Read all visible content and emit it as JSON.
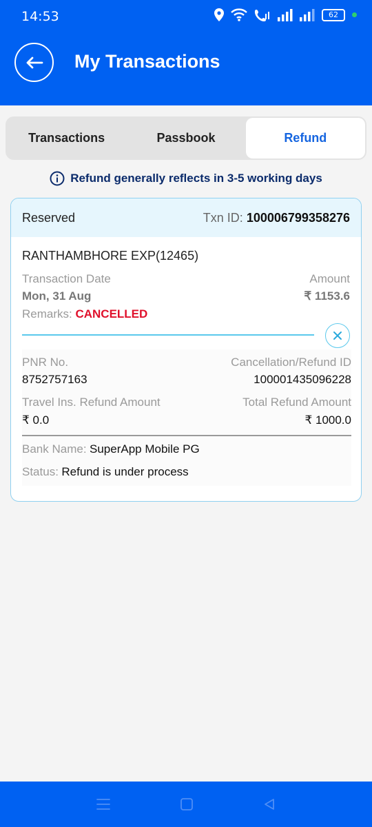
{
  "status_bar": {
    "time": "14:53",
    "battery": "62"
  },
  "header": {
    "title": "My Transactions"
  },
  "tabs": [
    {
      "label": "Transactions"
    },
    {
      "label": "Passbook"
    },
    {
      "label": "Refund"
    }
  ],
  "info": {
    "message": "Refund generally reflects in 3-5 working days"
  },
  "card": {
    "status": "Reserved",
    "txn_label": "Txn ID:",
    "txn_id": "100006799358276",
    "train": "RANTHAMBHORE EXP(12465)",
    "transaction_date_label": "Transaction Date",
    "transaction_date": "Mon, 31 Aug",
    "amount_label": "Amount",
    "amount": "₹ 1153.6",
    "remarks_label": "Remarks:",
    "remarks": "CANCELLED",
    "details": {
      "pnr_label": "PNR No.",
      "pnr": "8752757163",
      "refund_id_label": "Cancellation/Refund ID",
      "refund_id": "100001435096228",
      "travel_ins_label": "Travel Ins. Refund Amount",
      "travel_ins": "₹ 0.0",
      "total_refund_label": "Total Refund Amount",
      "total_refund": "₹ 1000.0",
      "bank_label": "Bank Name:",
      "bank": "SuperApp Mobile PG",
      "status_label": "Status:",
      "status": "Refund is under process"
    }
  }
}
